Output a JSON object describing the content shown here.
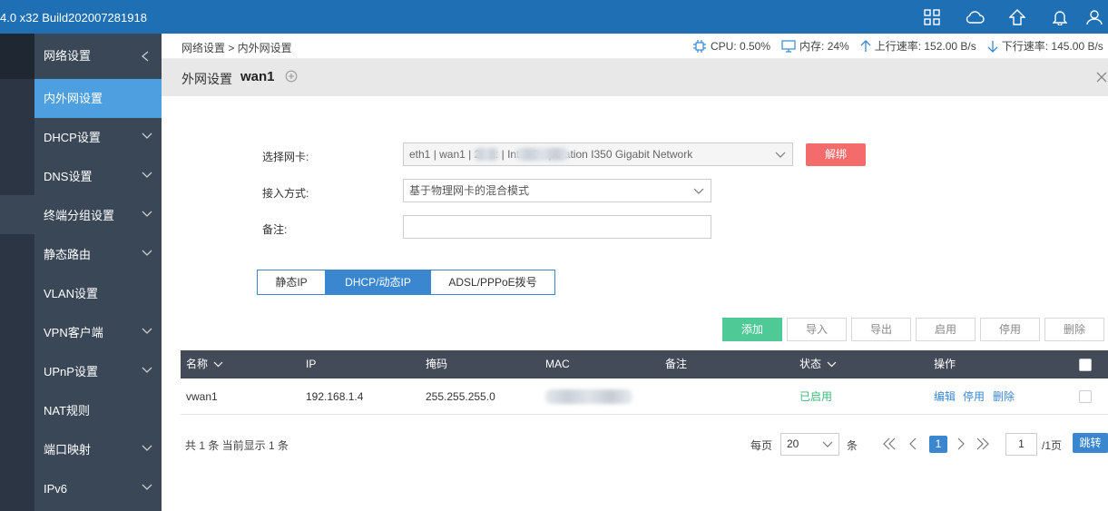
{
  "topbar": {
    "title": "4.0 x32 Build202007281918",
    "icons": [
      "apps-icon",
      "cloud-icon",
      "home-icon",
      "bell-icon",
      "user-icon"
    ]
  },
  "sidebar": {
    "header": "网络设置",
    "items": [
      {
        "label": "内外网设置",
        "active": true,
        "chevron": false
      },
      {
        "label": "DHCP设置",
        "chevron": true
      },
      {
        "label": "DNS设置",
        "chevron": true
      },
      {
        "label": "终端分组设置",
        "chevron": true
      },
      {
        "label": "静态路由",
        "chevron": true
      },
      {
        "label": "VLAN设置",
        "chevron": false
      },
      {
        "label": "VPN客户端",
        "chevron": true
      },
      {
        "label": "UPnP设置",
        "chevron": true
      },
      {
        "label": "NAT规则",
        "chevron": false
      },
      {
        "label": "端口映射",
        "chevron": true
      },
      {
        "label": "IPv6",
        "chevron": true
      }
    ]
  },
  "breadcrumb": "网络设置 > 内外网设置",
  "stats": {
    "cpu": "CPU: 0.50%",
    "mem": "内存: 24%",
    "up": "上行速率: 152.00 B/s",
    "down": "下行速率: 145.00 B/s"
  },
  "panel": {
    "title": "外网设置",
    "name": "wan1"
  },
  "form": {
    "nic_label": "选择网卡:",
    "nic_value": "eth1 | wan1 |       2:ba:         | Intel Corporation I350 Gigabit Network",
    "unbind_label": "解绑",
    "mode_label": "接入方式:",
    "mode_value": "基于物理网卡的混合模式",
    "note_label": "备注:",
    "note_value": ""
  },
  "tabs": [
    "静态IP",
    "DHCP/动态IP",
    "ADSL/PPPoE拨号"
  ],
  "actions": {
    "add": "添加",
    "import": "导入",
    "export": "导出",
    "enable": "启用",
    "disable": "停用",
    "delete": "删除"
  },
  "table": {
    "headers": [
      "名称",
      "IP",
      "掩码",
      "MAC",
      "备注",
      "状态",
      "操作"
    ],
    "rows": [
      {
        "name": "vwan1",
        "ip": "192.168.1.4",
        "mask": "255.255.255.0",
        "mac": "",
        "note": "",
        "status": "已启用",
        "ops": [
          "编辑",
          "停用",
          "删除"
        ]
      }
    ]
  },
  "footer": {
    "summary": "共 1 条 当前显示 1 条",
    "per_page_label": "每页",
    "per_page_value": "20",
    "unit": "条",
    "current_page": "1",
    "page_input": "1",
    "total_pages": "/1页",
    "jump": "跳转"
  }
}
